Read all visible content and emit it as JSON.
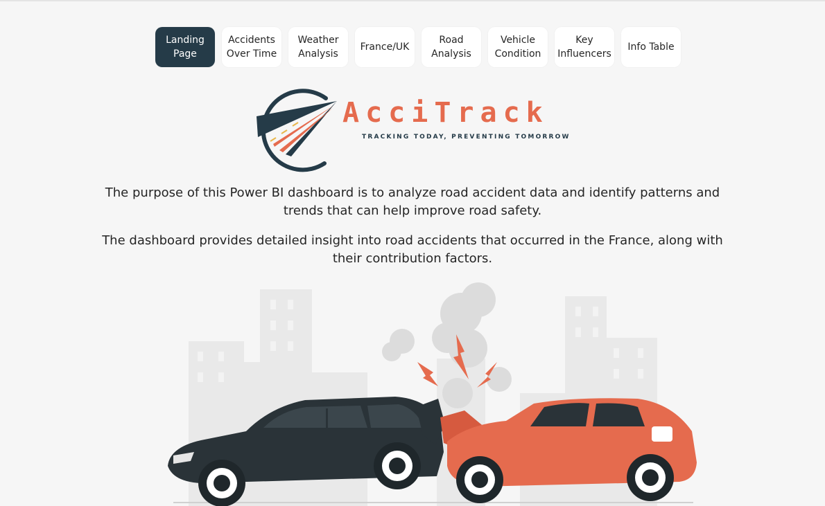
{
  "nav": {
    "items": [
      {
        "label": "Landing\nPage",
        "active": true
      },
      {
        "label": "Accidents\nOver Time",
        "active": false
      },
      {
        "label": "Weather\nAnalysis",
        "active": false
      },
      {
        "label": "France/UK",
        "active": false
      },
      {
        "label": "Road\nAnalysis",
        "active": false
      },
      {
        "label": "Vehicle\nCondition",
        "active": false
      },
      {
        "label": "Key\nInfluencers",
        "active": false
      },
      {
        "label": "Info Table",
        "active": false
      }
    ]
  },
  "brand": {
    "name": "AcciTrack",
    "tagline": "TRACKING TODAY, PREVENTING TOMORROW",
    "colors": {
      "primary": "#253b48",
      "accent": "#e56b4e"
    }
  },
  "description": {
    "paragraph1": "The purpose of this Power BI dashboard is to analyze road accident data and identify patterns and trends that can help improve road safety.",
    "paragraph2": "The dashboard provides detailed insight into road accidents that occurred in the France, along with their contribution factors."
  },
  "illustration": {
    "icon": "car-crash-illustration"
  }
}
